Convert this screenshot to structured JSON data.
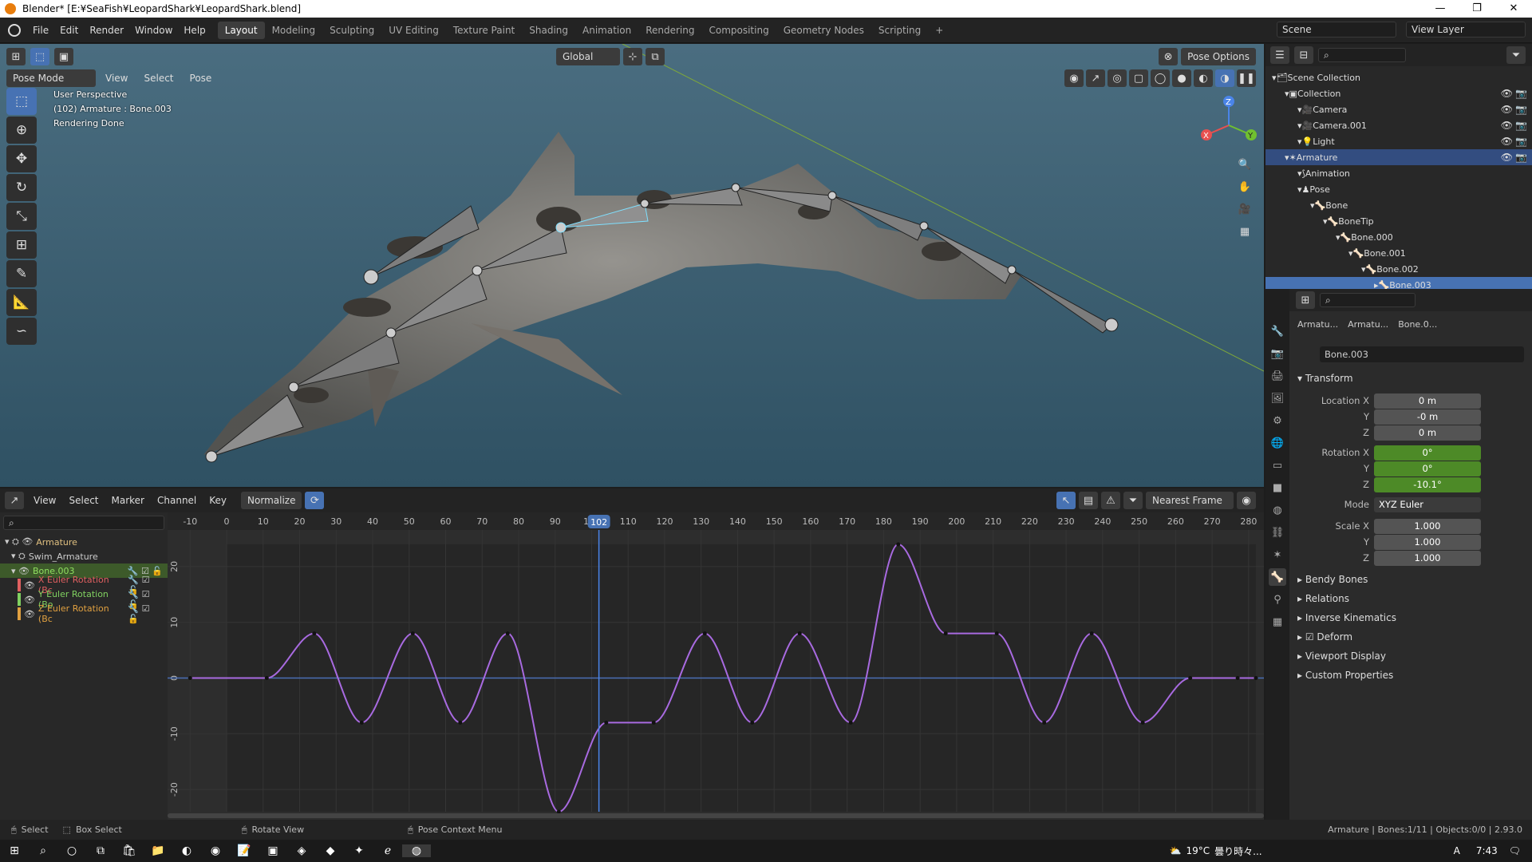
{
  "window": {
    "title": "Blender* [E:¥SeaFish¥LeopardShark¥LeopardShark.blend]",
    "min": "—",
    "max": "❐",
    "close": "✕"
  },
  "menu": [
    "File",
    "Edit",
    "Render",
    "Window",
    "Help"
  ],
  "workspaces": [
    "Layout",
    "Modeling",
    "Sculpting",
    "UV Editing",
    "Texture Paint",
    "Shading",
    "Animation",
    "Rendering",
    "Compositing",
    "Geometry Nodes",
    "Scripting",
    "+"
  ],
  "active_workspace": "Layout",
  "scene": {
    "label": "Scene",
    "view_layer": "View Layer"
  },
  "viewport": {
    "mode": "Pose Mode",
    "menus": [
      "View",
      "Select",
      "Pose"
    ],
    "orientation": "Global",
    "pose_options": "Pose Options",
    "info": [
      "User Perspective",
      "(102) Armature : Bone.003",
      "Rendering Done"
    ],
    "gizmo": {
      "x": "X",
      "y": "Y",
      "z": "Z"
    }
  },
  "graph": {
    "menus": [
      "View",
      "Select",
      "Marker",
      "Channel",
      "Key"
    ],
    "normalize": "Normalize",
    "snap": "Nearest Frame",
    "current_frame": "102",
    "frame_ticks": [
      "-10",
      "0",
      "10",
      "20",
      "30",
      "40",
      "50",
      "60",
      "70",
      "80",
      "90",
      "100",
      "110",
      "120",
      "130",
      "140",
      "150",
      "160",
      "170",
      "180",
      "190",
      "200",
      "210",
      "220",
      "230",
      "240",
      "250",
      "260",
      "270",
      "280"
    ],
    "value_ticks": [
      "20",
      "10",
      "0",
      "-10",
      "-20"
    ],
    "channels": [
      {
        "label": "Armature",
        "color": "#e0c080"
      },
      {
        "label": "Swim_Armature",
        "color": "#ccc"
      },
      {
        "label": "Bone.003",
        "color": "#90e060"
      },
      {
        "label": "X Euler Rotation (Bc",
        "color": "#e06060"
      },
      {
        "label": "Y Euler Rotation (Bo",
        "color": "#80d060"
      },
      {
        "label": "Z Euler Rotation (Bc",
        "color": "#e0a040"
      }
    ]
  },
  "outliner": {
    "rows": [
      {
        "label": "Scene Collection",
        "indent": 0
      },
      {
        "label": "Collection",
        "indent": 1
      },
      {
        "label": "Camera",
        "indent": 2
      },
      {
        "label": "Camera.001",
        "indent": 2
      },
      {
        "label": "Light",
        "indent": 2
      },
      {
        "label": "Armature",
        "indent": 1
      },
      {
        "label": "Animation",
        "indent": 2
      },
      {
        "label": "Pose",
        "indent": 2
      },
      {
        "label": "Bone",
        "indent": 3
      },
      {
        "label": "BoneTip",
        "indent": 4
      },
      {
        "label": "Bone.000",
        "indent": 5
      },
      {
        "label": "Bone.001",
        "indent": 6
      },
      {
        "label": "Bone.002",
        "indent": 7
      },
      {
        "label": "Bone.003",
        "indent": 8
      }
    ]
  },
  "properties": {
    "breadcrumb": [
      "Armatu...",
      "Armatu...",
      "Bone.0..."
    ],
    "bone_name": "Bone.003",
    "transform_label": "Transform",
    "location": {
      "label": "Location X",
      "x": "0 m",
      "y": "-0 m",
      "z": "0 m"
    },
    "rotation": {
      "label": "Rotation X",
      "x": "0°",
      "y": "0°",
      "z": "-10.1°"
    },
    "mode": {
      "label": "Mode",
      "value": "XYZ Euler"
    },
    "scale": {
      "label": "Scale X",
      "x": "1.000",
      "y": "1.000",
      "z": "1.000"
    },
    "axis_y": "Y",
    "axis_z": "Z",
    "panels": [
      "Bendy Bones",
      "Relations",
      "Inverse Kinematics",
      "Deform",
      "Viewport Display",
      "Custom Properties"
    ]
  },
  "status": {
    "select": "Select",
    "box_select": "Box Select",
    "rotate_view": "Rotate View",
    "context": "Pose Context Menu",
    "info": "Armature | Bones:1/11 | Objects:0/0 | 2.93.0"
  },
  "taskbar": {
    "weather": "19°C",
    "weather_text": "曇り時々...",
    "time": "7:43",
    "lang": "A"
  },
  "chart_data": {
    "type": "line",
    "title": "",
    "xlabel": "",
    "ylabel": "",
    "xlim": [
      -10,
      282
    ],
    "ylim": [
      -24,
      24
    ],
    "series": [
      {
        "name": "Z Euler Rotation",
        "color": "#a86ae0",
        "x": [
          -10,
          11,
          24,
          37,
          51,
          64,
          77,
          91,
          104,
          117,
          131,
          144,
          157,
          171,
          184,
          197,
          211,
          224,
          237,
          251,
          264,
          277,
          282
        ],
        "y": [
          0,
          0,
          8,
          -8,
          8,
          -8,
          8,
          -24,
          -8,
          -8,
          8,
          -8,
          8,
          -8,
          24,
          8,
          8,
          -8,
          8,
          -8,
          0,
          0,
          0
        ]
      }
    ]
  }
}
